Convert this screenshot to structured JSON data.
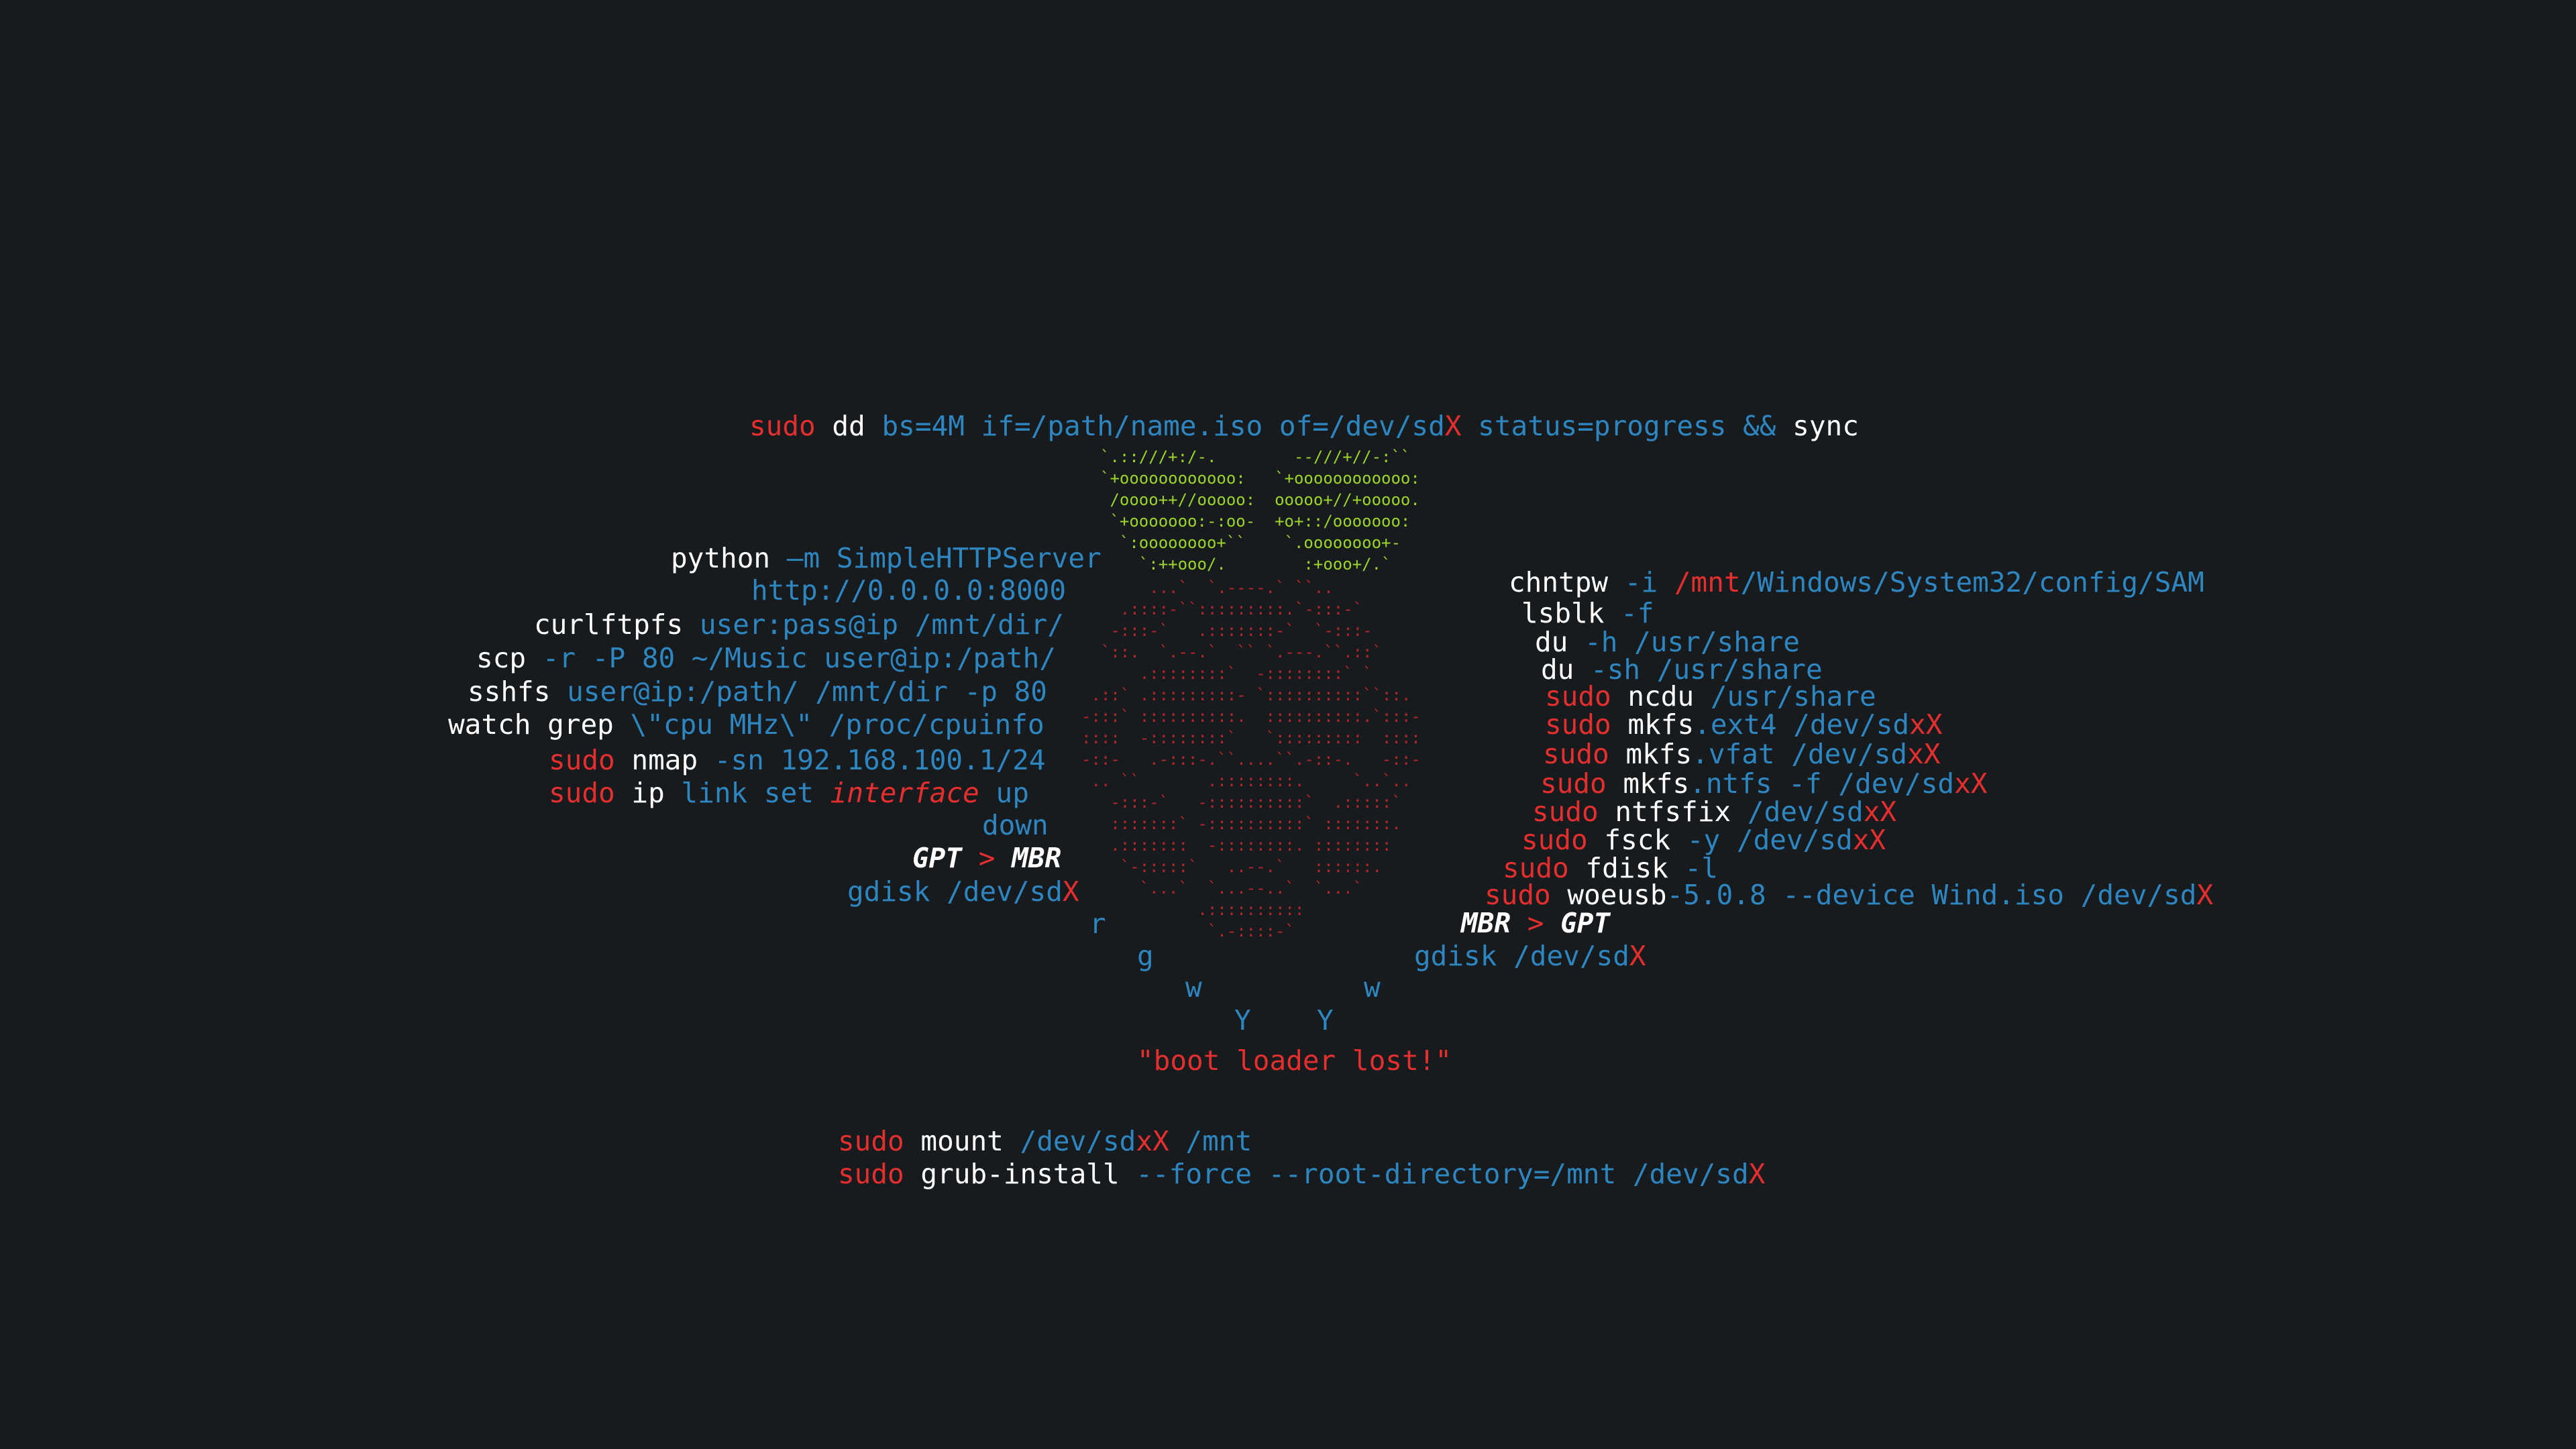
{
  "colors": {
    "background": "#181b1e",
    "white": "#ffffff",
    "red": "#e52e2e",
    "blue": "#2e86c1",
    "green": "#9bd52a",
    "dark_red": "#b8262a"
  },
  "art": {
    "green": "`.::///+:/-.        --///+//-:``\n`+oooooooooooo:   `+oooooooooooo:\n /oooo++//ooooo:  ooooo+//+ooooo.\n `+ooooooo:-:oo-  +o+::/ooooooo:\n  `:oooooooo+``    `.oooooooo+-\n    `:++ooo/.        :+ooo+/.`",
    "red": "       ...`  `.----.` ``..\n    .::::-``:::::::::.`-:::-`\n   -:::-`   .:::::::-`  `-:::-\n  `::.  `.--.`  `` `.---.``.::`\n      .::::::::`  -::::::::` `\n .::` .:::::::::- `::::::::::``::.\n-:::` ::::::::::.  ::::::::::.`:::-\n::::  -::::::::`   `:::::::::  ::::\n-::-   .-:::-.``....``.-::-.   -::-\n .. ``       .::::::::.     `..`..\n   -:::-`   -::::::::::`  .:::::`\n   :::::::` -::::::::::` :::::::.\n   .:::::::  -::::::::. ::::::::\n    `-:::::`   ..--.`   ::::::.\n      `...`  `...--..`  `...`\n            .::::::::::\n             `.-::::-`"
  },
  "lines": {
    "dd": [
      "sudo",
      " dd ",
      "bs=4M if=/path/name.iso of=/dev/sd",
      "X",
      " status=progress && ",
      "sync"
    ],
    "python": [
      "python ",
      "—m SimpleHTTPServer"
    ],
    "http": "http://0.0.0.0:8000",
    "curlftpfs": [
      "curlftpfs ",
      "user:pass@ip /mnt/dir/"
    ],
    "scp": [
      "scp ",
      "-r -P 80 ~/Music user@ip:/path/"
    ],
    "sshfs": [
      "sshfs ",
      "user@ip:/path/ /mnt/dir -p 80"
    ],
    "watch": [
      "watch grep ",
      "\\\"cpu MHz\\\" /proc/cpuinfo"
    ],
    "nmap": [
      "sudo",
      " nmap ",
      "-sn 192.168.100.1/24"
    ],
    "ip": [
      "sudo",
      " ip ",
      "link set ",
      "interface",
      " up"
    ],
    "down": "down",
    "gpt_mbr": [
      "GPT",
      " > ",
      "MBR"
    ],
    "gdisk_left": [
      "gdisk /dev/sd",
      "X"
    ],
    "chntpw": [
      "chntpw ",
      "-i ",
      "/mnt",
      "/Windows/System32/config/SAM"
    ],
    "lsblk": [
      "lsblk ",
      "-f"
    ],
    "du_h": [
      "du ",
      "-h /usr/share"
    ],
    "du_sh": [
      "du ",
      "-sh /usr/share"
    ],
    "ncdu": [
      "sudo",
      " ncdu ",
      "/usr/share"
    ],
    "mkfs_ext4": [
      "sudo",
      " mkfs",
      ".ext4 /dev/sd",
      "xX"
    ],
    "mkfs_vfat": [
      "sudo",
      " mkfs",
      ".vfat /dev/sd",
      "xX"
    ],
    "mkfs_ntfs": [
      "sudo",
      " mkfs",
      ".ntfs -f /dev/sd",
      "xX"
    ],
    "ntfsfix": [
      "sudo",
      " ntfsfix ",
      "/dev/sd",
      "xX"
    ],
    "fsck": [
      "sudo",
      " fsck ",
      "-y /dev/sd",
      "xX"
    ],
    "fdisk": [
      "sudo",
      " fdisk ",
      "-l"
    ],
    "woeusb": [
      "sudo",
      " woeusb",
      "-5.0.8 --device Wind.iso /dev/sd",
      "X"
    ],
    "mbr_gpt": [
      "MBR",
      " > ",
      "GPT"
    ],
    "gdisk_right": [
      "gdisk /dev/sd",
      "X"
    ],
    "r": "r",
    "g": "g",
    "w1": "w",
    "w2": "w",
    "y1": "Y",
    "y2": "Y",
    "boot_lost": "\"boot loader lost!\"",
    "mount": [
      "sudo",
      " mount ",
      "/dev/sd",
      "xX",
      " /mnt"
    ],
    "grub": [
      "sudo",
      " grub-install ",
      "--force --root-directory=/mnt /dev/sd",
      "X"
    ]
  }
}
